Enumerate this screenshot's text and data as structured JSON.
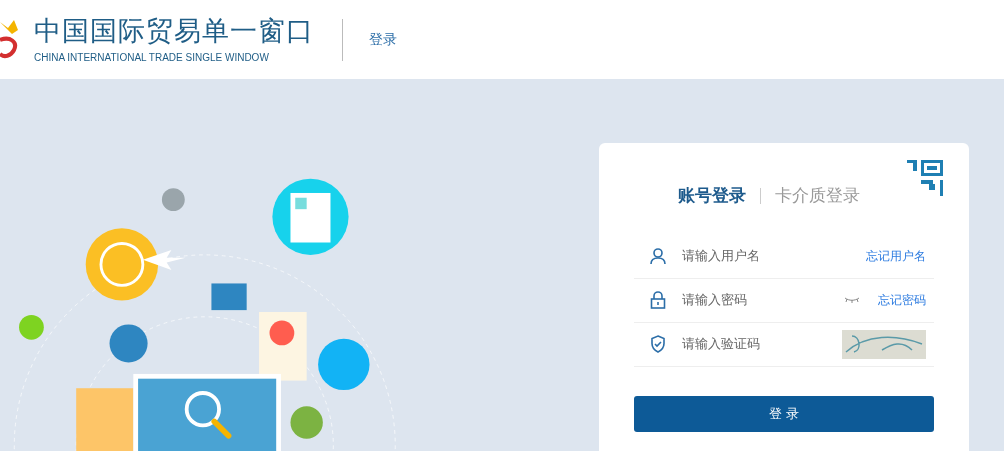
{
  "header": {
    "title": "中国国际贸易单一窗口",
    "subtitle": "CHINA INTERNATIONAL TRADE SINGLE WINDOW",
    "nav_link": "登录"
  },
  "login": {
    "tabs": [
      {
        "label": "账号登录",
        "selected": true
      },
      {
        "label": "卡介质登录",
        "selected": false
      }
    ],
    "fields": [
      {
        "kind": "user",
        "placeholder": "请输入用户名",
        "link": "忘记用户名"
      },
      {
        "kind": "password",
        "placeholder": "请输入密码",
        "link": "忘记密码"
      },
      {
        "kind": "captcha",
        "placeholder": "请输入验证码"
      }
    ],
    "button": "登 录"
  }
}
